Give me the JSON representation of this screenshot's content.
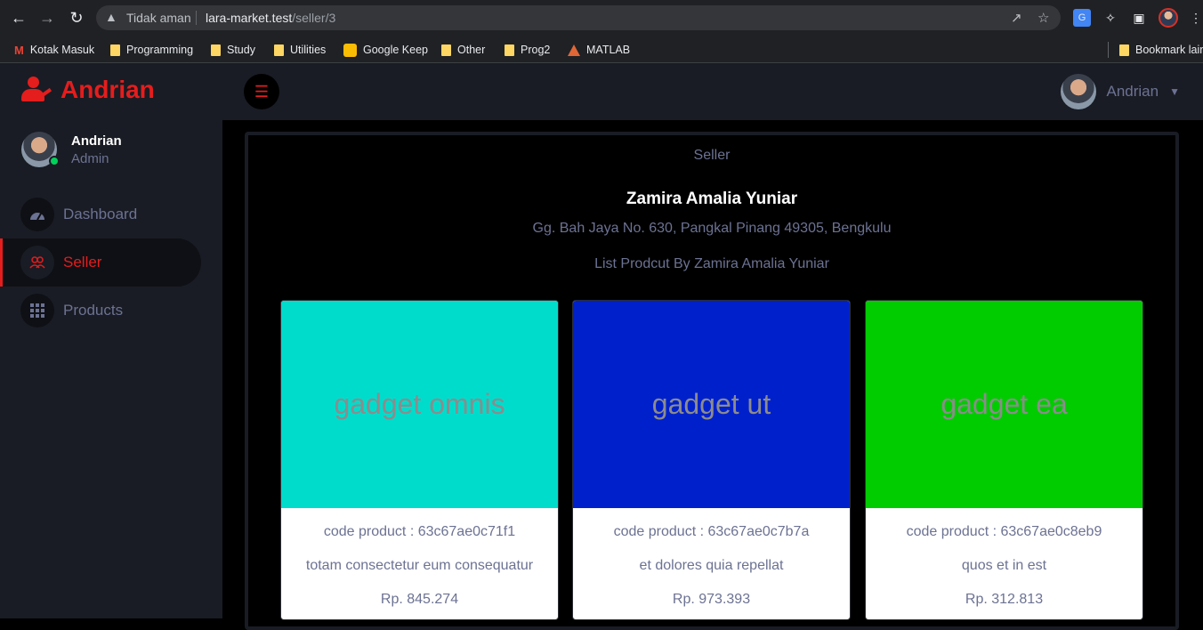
{
  "browser": {
    "security_label": "Tidak aman",
    "url_host": "lara-market.test",
    "url_path": "/seller/3",
    "bookmarks": [
      "Kotak Masuk",
      "Programming",
      "Study",
      "Utilities",
      "Google Keep",
      "Other",
      "Prog2",
      "MATLAB"
    ],
    "other_bookmarks": "Bookmark lain"
  },
  "brand": {
    "name": "Andrian"
  },
  "sidebar": {
    "user": {
      "name": "Andrian",
      "role": "Admin"
    },
    "items": [
      {
        "label": "Dashboard",
        "icon": "speedometer-icon"
      },
      {
        "label": "Seller",
        "icon": "users-icon"
      },
      {
        "label": "Products",
        "icon": "grid-icon"
      }
    ]
  },
  "topbar": {
    "user_name": "Andrian"
  },
  "content": {
    "title": "Seller",
    "seller_name": "Zamira Amalia Yuniar",
    "seller_address": "Gg. Bah Jaya No. 630, Pangkal Pinang 49305, Bengkulu",
    "list_title": "List Prodcut By Zamira Amalia Yuniar",
    "products": [
      {
        "image_text": "gadget omnis",
        "color": "#00dccc",
        "code": "code product : 63c67ae0c71f1",
        "name": "totam consectetur eum consequatur",
        "price": "Rp. 845.274"
      },
      {
        "image_text": "gadget ut",
        "color": "#0020cc",
        "code": "code product : 63c67ae0c7b7a",
        "name": "et dolores quia repellat",
        "price": "Rp. 973.393"
      },
      {
        "image_text": "gadget ea",
        "color": "#00cc00",
        "code": "code product : 63c67ae0c8eb9",
        "name": "quos et in est",
        "price": "Rp. 312.813"
      }
    ]
  }
}
